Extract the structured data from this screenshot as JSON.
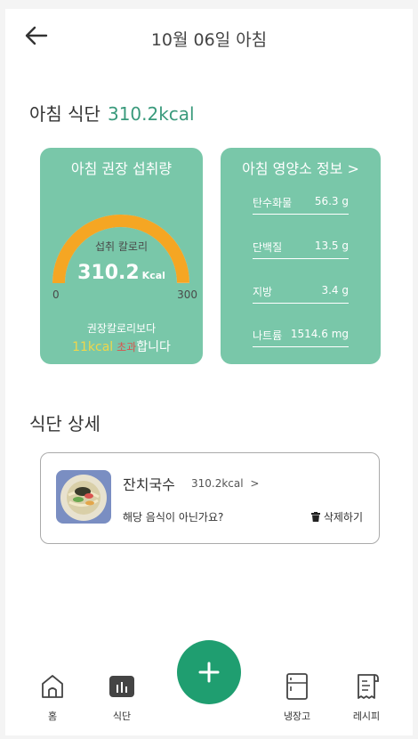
{
  "header": {
    "title": "10월 06일 아침",
    "back_icon": "arrow-left-icon"
  },
  "meal": {
    "title": "아침 식단",
    "kcal": "310.2kcal"
  },
  "recommend_card": {
    "title": "아침 권장 섭취량",
    "gauge_label": "섭취 칼로리",
    "value": "310.2",
    "unit": "Kcal",
    "min": "0",
    "max": "300",
    "fill_fraction": 1.0,
    "note_line1": "권장칼로리보다",
    "over_amount": "11kcal",
    "over_word": "초과",
    "note_tail": "합니다",
    "colors": {
      "card": "#79c7a9",
      "gauge": "#f5a623"
    }
  },
  "nutrition_card": {
    "title": "아침 영양소 정보 >",
    "items": [
      {
        "name": "탄수화물",
        "value": "56.3 g"
      },
      {
        "name": "단백질",
        "value": "13.5 g"
      },
      {
        "name": "지방",
        "value": "3.4 g"
      },
      {
        "name": "나트륨",
        "value": "1514.6 mg"
      }
    ]
  },
  "detail": {
    "title": "식단 상세",
    "food": {
      "name": "잔치국수",
      "kcal": "310.2kcal",
      "chevron": ">",
      "question": "해당 음식이 아닌가요?",
      "delete_label": "삭제하기"
    }
  },
  "bottom_nav": {
    "items": [
      {
        "label": "홈",
        "icon": "home-icon"
      },
      {
        "label": "식단",
        "icon": "bar-chart-icon"
      },
      {
        "label": "냉장고",
        "icon": "fridge-icon"
      },
      {
        "label": "레시피",
        "icon": "recipe-icon"
      }
    ],
    "fab_icon": "plus-icon",
    "accent": "#1f9e70"
  }
}
